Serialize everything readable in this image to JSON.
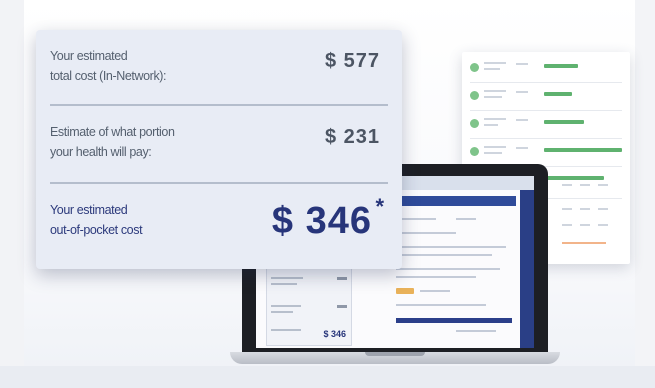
{
  "cost_card": {
    "total_cost_line1": "Your estimated",
    "total_cost_line2": "total cost (In-Network):",
    "total_cost_value": "$ 577",
    "plan_pays_line1": "Estimate of what portion",
    "plan_pays_line2": "your health will pay:",
    "plan_pays_value": "$ 231",
    "oop_line1": "Your estimated",
    "oop_line2": "out-of-pocket cost",
    "oop_value": "$ 346",
    "oop_marker": "*"
  },
  "laptop_screen": {
    "mini_total": "$ 346"
  },
  "colors": {
    "accent_navy": "#27357a",
    "card_bg": "#e8ecf5",
    "report_green": "#5fb26f"
  }
}
